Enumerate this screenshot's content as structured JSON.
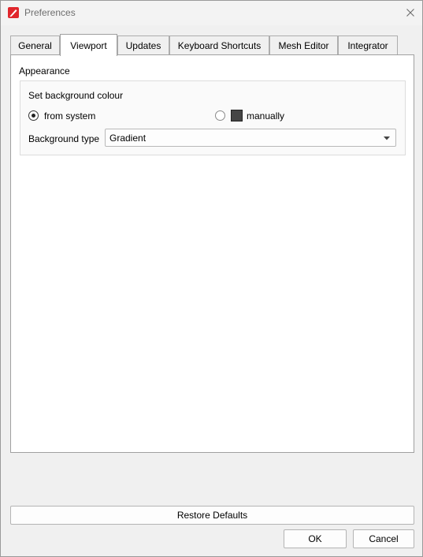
{
  "window": {
    "title": "Preferences"
  },
  "tabs": [
    {
      "label": "General"
    },
    {
      "label": "Viewport"
    },
    {
      "label": "Updates"
    },
    {
      "label": "Keyboard Shortcuts"
    },
    {
      "label": "Mesh Editor"
    },
    {
      "label": "Integrator"
    }
  ],
  "active_tab": "Viewport",
  "appearance": {
    "title": "Appearance",
    "group_label": "Set background colour",
    "options": [
      {
        "label": "from system",
        "selected": true
      },
      {
        "label": "manually",
        "selected": false,
        "swatch_color": "#454545"
      }
    ],
    "background_type_label": "Background type",
    "background_type_value": "Gradient"
  },
  "buttons": {
    "restore": "Restore Defaults",
    "ok": "OK",
    "cancel": "Cancel"
  },
  "icons": {
    "app": "pencil-app-icon",
    "close": "close-icon",
    "dropdown": "chevron-down-icon"
  },
  "colors": {
    "app_icon": "#e0262c",
    "swatch": "#454545"
  }
}
